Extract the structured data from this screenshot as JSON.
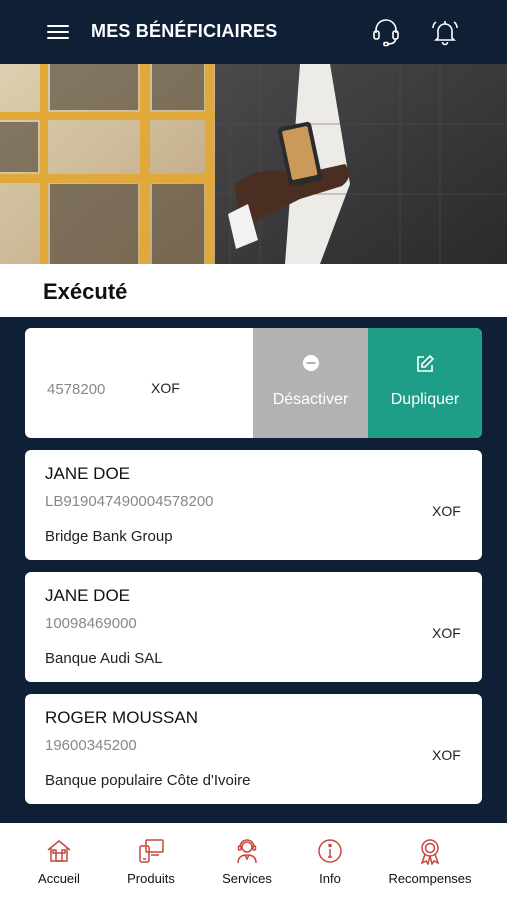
{
  "header": {
    "title": "MES BÉNÉFICIAIRES",
    "menu_icon": "hamburger-menu-icon",
    "support_icon": "headset-icon",
    "notifications_icon": "bell-icon"
  },
  "status": {
    "title": "Exécuté"
  },
  "swiped_card": {
    "account": "4578200",
    "currency": "XOF",
    "actions": {
      "deactivate_label": "Désactiver",
      "duplicate_label": "Dupliquer"
    }
  },
  "beneficiaries": [
    {
      "name": "JANE DOE",
      "account": "LB919047490004578200",
      "bank": "Bridge Bank Group",
      "currency": "XOF"
    },
    {
      "name": "JANE DOE",
      "account": "10098469000",
      "bank": "Banque Audi SAL",
      "currency": "XOF"
    },
    {
      "name": "ROGER MOUSSAN",
      "account": "19600345200",
      "bank": "Banque populaire Côte d'Ivoire",
      "currency": "XOF"
    }
  ],
  "nav": [
    {
      "label": "Accueil",
      "icon": "home-icon"
    },
    {
      "label": "Produits",
      "icon": "devices-icon"
    },
    {
      "label": "Services",
      "icon": "agent-icon"
    },
    {
      "label": "Info",
      "icon": "info-icon"
    },
    {
      "label": "Recompenses",
      "icon": "award-icon"
    }
  ],
  "colors": {
    "header_bg": "#0f1f36",
    "accent_teal": "#1e9e87",
    "deactivate_gray": "#b2b2b2",
    "nav_icon_red": "#c8473b"
  }
}
